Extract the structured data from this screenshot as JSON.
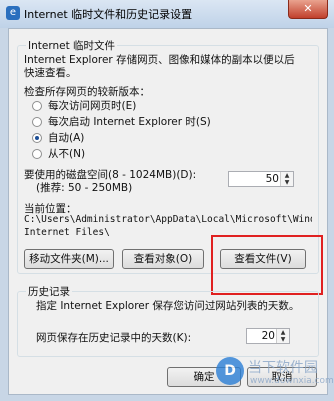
{
  "window": {
    "title": "Internet 临时文件和历史记录设置",
    "close_label": "✕"
  },
  "temp_files": {
    "group_title": "Internet 临时文件",
    "description_line1": "Internet Explorer 存储网页、图像和媒体的副本以便以后",
    "description_line2": "快速查看。",
    "check_label": "检查所存网页的较新版本：",
    "options": [
      {
        "label": "每次访问网页时(E)",
        "selected": false
      },
      {
        "label": "每次启动 Internet Explorer 时(S)",
        "selected": false
      },
      {
        "label": "自动(A)",
        "selected": true
      },
      {
        "label": "从不(N)",
        "selected": false
      }
    ],
    "disk_label_line1": "要使用的磁盘空间(8 - 1024MB)(D):",
    "disk_label_line2": "(推荐: 50 - 250MB)",
    "disk_value": "50",
    "location_label": "当前位置：",
    "location_line1": "C:\\Users\\Administrator\\AppData\\Local\\Microsoft\\Window",
    "location_line2": "Internet Files\\",
    "buttons": {
      "move_folder": "移动文件夹(M)...",
      "view_objects": "查看对象(O)",
      "view_files": "查看文件(V)"
    }
  },
  "history": {
    "group_title": "历史记录",
    "description": "指定 Internet Explorer 保存您访问过网站列表的天数。",
    "days_label": "网页保存在历史记录中的天数(K):",
    "days_value": "20"
  },
  "footer": {
    "ok": "确定",
    "cancel": "取消"
  },
  "watermark": {
    "name": "当下软件园",
    "url": "www.downxia.com"
  },
  "colors": {
    "highlight": "#e02020",
    "close_button": "#c1402c"
  }
}
